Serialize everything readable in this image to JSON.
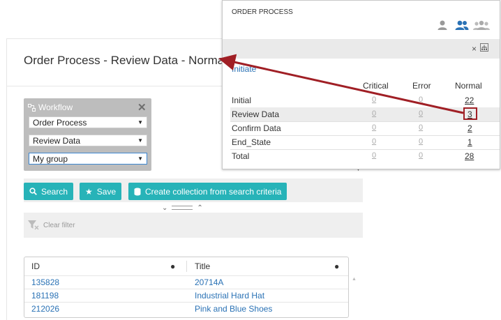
{
  "page": {
    "title": "Order Process - Review Data - Normal"
  },
  "workflow": {
    "label": "Workflow",
    "close": "✕",
    "process_value": "Order Process",
    "step_value": "Review Data",
    "group_value": "My group"
  },
  "toolbar": {
    "search_label": "Search",
    "save_label": "Save",
    "collection_label": "Create collection from search criteria"
  },
  "filter": {
    "clear_label": "Clear filter"
  },
  "table": {
    "columns": [
      "ID",
      "Title"
    ],
    "rows": [
      {
        "id": "135828",
        "title": "20714A"
      },
      {
        "id": "181198",
        "title": "Industrial Hard Hat"
      },
      {
        "id": "212026",
        "title": "Pink and Blue Shoes"
      }
    ]
  },
  "popup": {
    "title": "ORDER PROCESS",
    "close": "×",
    "initiate": "Initiate",
    "headers": {
      "critical": "Critical",
      "error": "Error",
      "normal": "Normal"
    },
    "rows": [
      {
        "label": "Initial",
        "critical": "0",
        "error": "0",
        "normal": "22"
      },
      {
        "label": "Review Data",
        "critical": "0",
        "error": "0",
        "normal": "3"
      },
      {
        "label": "Confirm Data",
        "critical": "0",
        "error": "0",
        "normal": "2"
      },
      {
        "label": "End_State",
        "critical": "0",
        "error": "0",
        "normal": "1"
      },
      {
        "label": "Total",
        "critical": "0",
        "error": "0",
        "normal": "28"
      }
    ]
  },
  "colors": {
    "accent": "#27b3b8",
    "link": "#2a72b5",
    "annotation": "#a01f25"
  },
  "icons": {
    "workflow": "workflow-icon",
    "search": "search-icon",
    "save": "star-icon",
    "collection": "database-icon",
    "filter": "filter-icon",
    "users": "user-icons",
    "tree": "hierarchy-icon"
  }
}
